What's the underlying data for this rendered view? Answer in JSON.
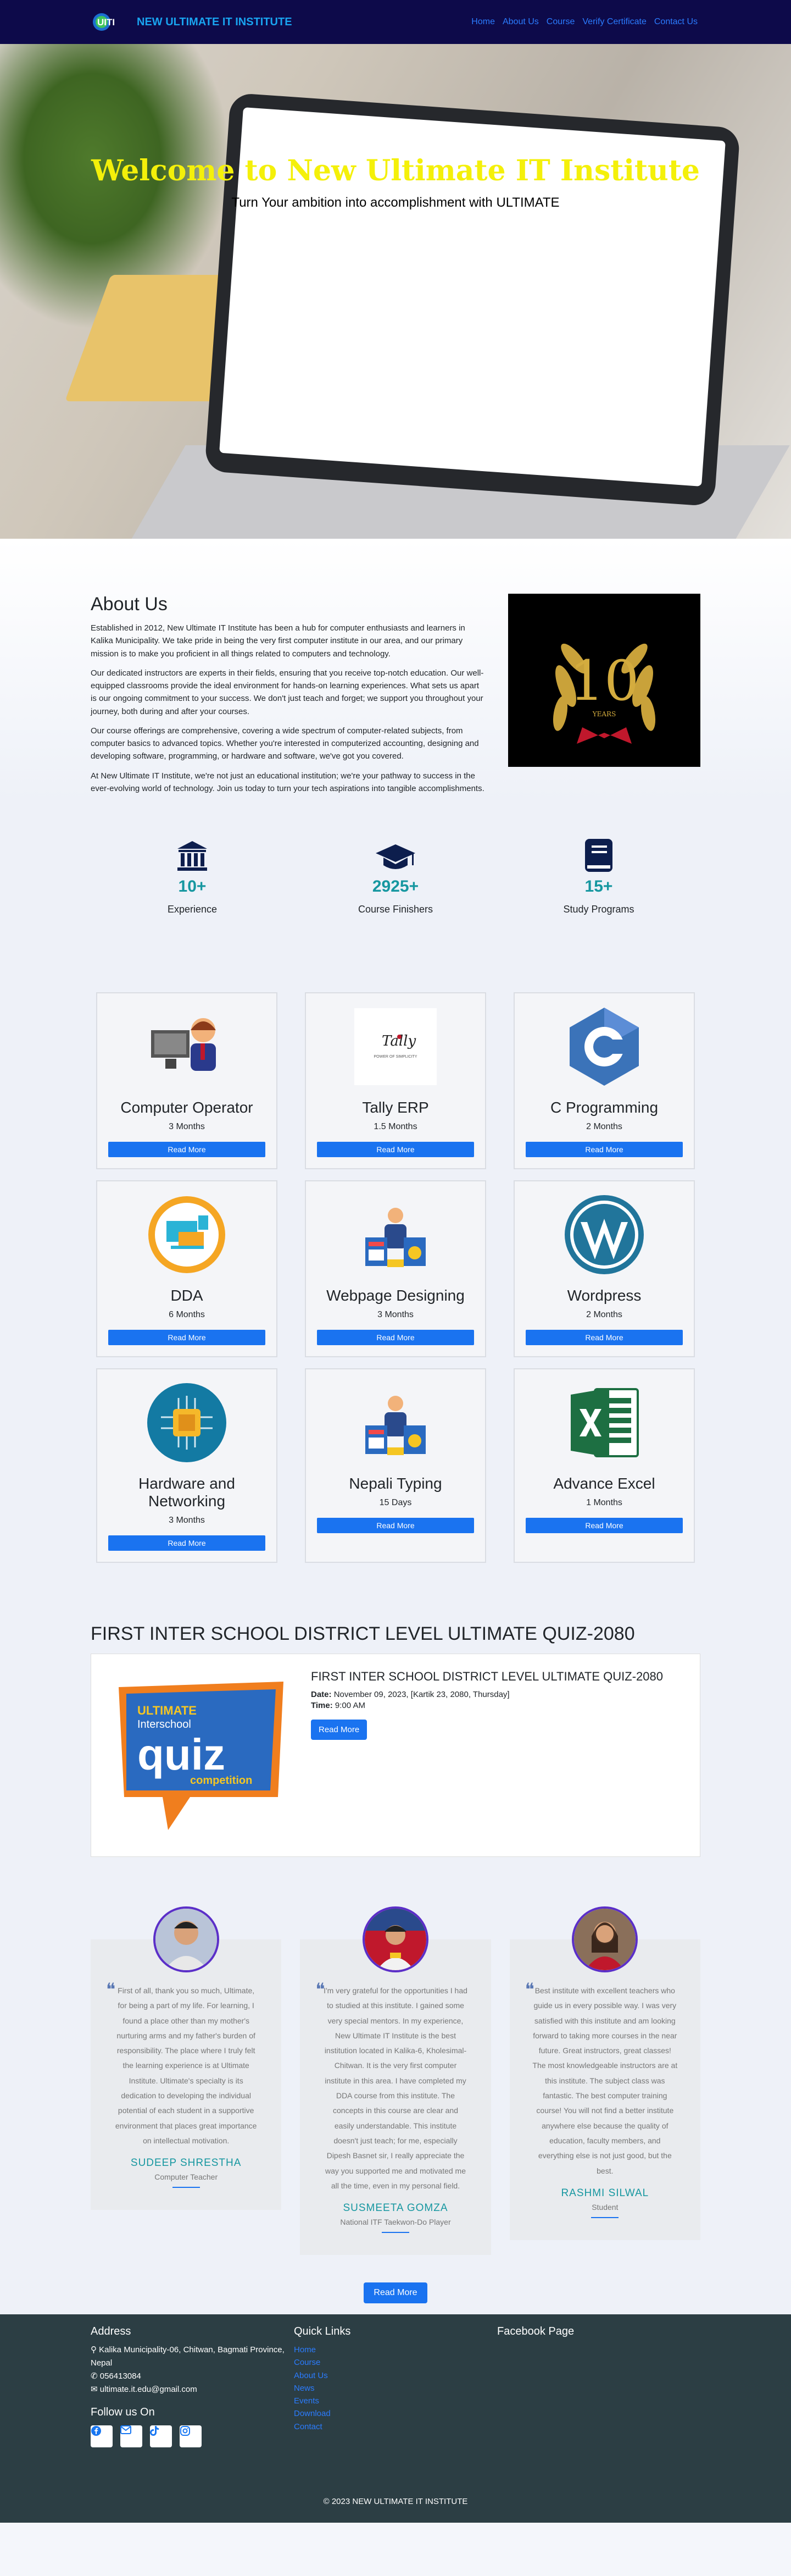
{
  "nav": {
    "brand": "NEW ULTIMATE IT INSTITUTE",
    "logo_text": "UITI",
    "links": [
      "Home",
      "About Us",
      "Course",
      "Verify Certificate",
      "Contact Us"
    ]
  },
  "hero": {
    "title": "Welcome to New Ultimate IT Institute",
    "subtitle": "Turn Your ambition into accomplishment with ULTIMATE"
  },
  "about": {
    "heading": "About Us",
    "paragraphs": [
      "Established in 2012, New Ultimate IT Institute has been a hub for computer enthusiasts and learners in Kalika Municipality. We take pride in being the very first computer institute in our area, and our primary mission is to make you proficient in all things related to computers and technology.",
      "Our dedicated instructors are experts in their fields, ensuring that you receive top-notch education. Our well-equipped classrooms provide the ideal environment for hands-on learning experiences. What sets us apart is our ongoing commitment to your success. We don't just teach and forget; we support you throughout your journey, both during and after your courses.",
      "Our course offerings are comprehensive, covering a wide spectrum of computer-related subjects, from computer basics to advanced topics. Whether you're interested in computerized accounting, designing and developing software, programming, or hardware and software, we've got you covered.",
      "At New Ultimate IT Institute, we're not just an educational institution; we're your pathway to success in the ever-evolving world of technology. Join us today to turn your tech aspirations into tangible accomplishments."
    ],
    "badge_number": "10",
    "badge_text": "YEARS"
  },
  "stats": [
    {
      "value": "10+",
      "label": "Experience",
      "icon": "institution-icon"
    },
    {
      "value": "2925+",
      "label": "Course Finishers",
      "icon": "graduation-cap-icon"
    },
    {
      "value": "15+",
      "label": "Study Programs",
      "icon": "book-icon"
    }
  ],
  "courses": [
    {
      "title": "Computer Operator",
      "duration": "3 Months",
      "button": "Read More"
    },
    {
      "title": "Tally ERP",
      "duration": "1.5 Months",
      "button": "Read More"
    },
    {
      "title": "C Programming",
      "duration": "2 Months",
      "button": "Read More"
    },
    {
      "title": "DDA",
      "duration": "6 Months",
      "button": "Read More"
    },
    {
      "title": "Webpage Designing",
      "duration": "3 Months",
      "button": "Read More"
    },
    {
      "title": "Wordpress",
      "duration": "2 Months",
      "button": "Read More"
    },
    {
      "title": "Hardware and Networking",
      "duration": "3 Months",
      "button": "Read More"
    },
    {
      "title": "Nepali Typing",
      "duration": "15 Days",
      "button": "Read More"
    },
    {
      "title": "Advance Excel",
      "duration": "1 Months",
      "button": "Read More"
    }
  ],
  "tally_logo": {
    "name": "Tally",
    "tagline": "POWER OF SIMPLICITY"
  },
  "quiz": {
    "heading": "FIRST INTER SCHOOL DISTRICT LEVEL ULTIMATE QUIZ-2080",
    "title": "FIRST INTER SCHOOL DISTRICT LEVEL ULTIMATE QUIZ-2080",
    "date_label": "Date:",
    "date_value": "November 09, 2023, [Kartik 23, 2080, Thursday]",
    "time_label": "Time:",
    "time_value": "9:00 AM",
    "button": "Read More",
    "poster_line1": "ULTIMATE",
    "poster_line2": "Interschool",
    "poster_line3": "quiz",
    "poster_line4": "competition"
  },
  "testimonials": [
    {
      "text": "First of all, thank you so much, Ultimate, for being a part of my life. For learning, I found a place other than my mother's nurturing arms and my father's burden of responsibility. The place where I truly felt the learning experience is at Ultimate Institute. Ultimate's specialty is its dedication to developing the individual potential of each student in a supportive environment that places great importance on intellectual motivation.",
      "name": "SUDEEP SHRESTHA",
      "role": "Computer Teacher"
    },
    {
      "text": "I'm very grateful for the opportunities I had to studied at this institute. I gained some very special mentors. In my experience, New Ultimate IT Institute is the best institution located in Kalika-6, Kholesimal-Chitwan. It is the very first computer institute in this area. I have completed my DDA course from this institute. The concepts in this course are clear and easily understandable. This institute doesn't just teach; for me, especially Dipesh Basnet sir, I really appreciate the way you supported me and motivated me all the time, even in my personal field.",
      "name": "SUSMEETA GOMZA",
      "role": "National ITF Taekwon-Do Player"
    },
    {
      "text": "Best institute with excellent teachers who guide us in every possible way. I was very satisfied with this institute and am looking forward to taking more courses in the near future. Great instructors, great classes! The most knowledgeable instructors are at this institute. The subject class was fantastic. The best computer training course! You will not find a better institute anywhere else because the quality of education, faculty members, and everything else is not just good, but the best.",
      "name": "RASHMI SILWAL",
      "role": "Student"
    }
  ],
  "testimonials_button": "Read More",
  "footer": {
    "address_heading": "Address",
    "address": "Kalika Municipality-06, Chitwan, Bagmati Province, Nepal",
    "phone": "056413084",
    "email": "ultimate.it.edu@gmail.com",
    "follow": "Follow us On",
    "quick_heading": "Quick Links",
    "quick_links": [
      "Home",
      "Course",
      "About Us",
      "News",
      "Events",
      "Download",
      "Contact"
    ],
    "fb_heading": "Facebook Page",
    "copyright": "© 2023 NEW ULTIMATE IT INSTITUTE"
  },
  "colors": {
    "nav_bg": "#0d0a4a",
    "accent": "#1a73f0",
    "teal": "#1697a0",
    "hero_title": "#f4f00a",
    "footer_bg": "#2c3e44"
  }
}
